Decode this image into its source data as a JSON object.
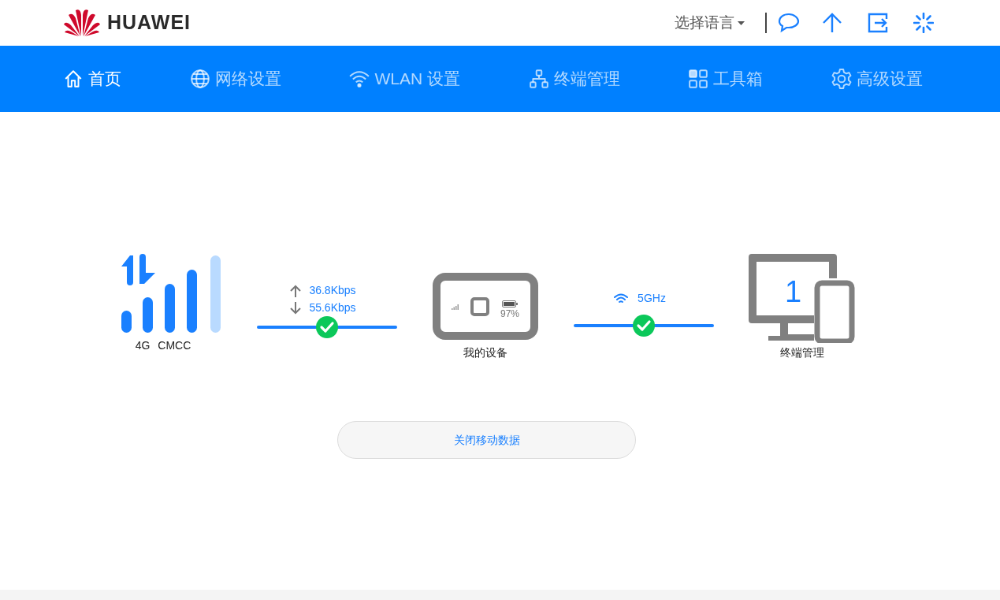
{
  "header": {
    "brand": "HUAWEI",
    "language": "选择语言"
  },
  "nav": [
    {
      "label": "首页",
      "kind": "home",
      "selected": true
    },
    {
      "label": "网络设置",
      "kind": "globe",
      "selected": false
    },
    {
      "label": "WLAN 设置",
      "kind": "wifi",
      "selected": false
    },
    {
      "label": "终端管理",
      "kind": "network",
      "selected": false
    },
    {
      "label": "工具箱",
      "kind": "grid",
      "selected": false
    },
    {
      "label": "高级设置",
      "kind": "gear",
      "selected": false
    }
  ],
  "mobile": {
    "network_type": "4G",
    "operator": "CMCC",
    "upload": "36.8Kbps",
    "download": "55.6Kbps",
    "connected": true
  },
  "device": {
    "label": "我的设备",
    "battery": "97%"
  },
  "wifi": {
    "band": "5GHz",
    "connected": true
  },
  "terminals": {
    "count": "1",
    "label": "终端管理"
  },
  "action_button": "关闭移动数据"
}
